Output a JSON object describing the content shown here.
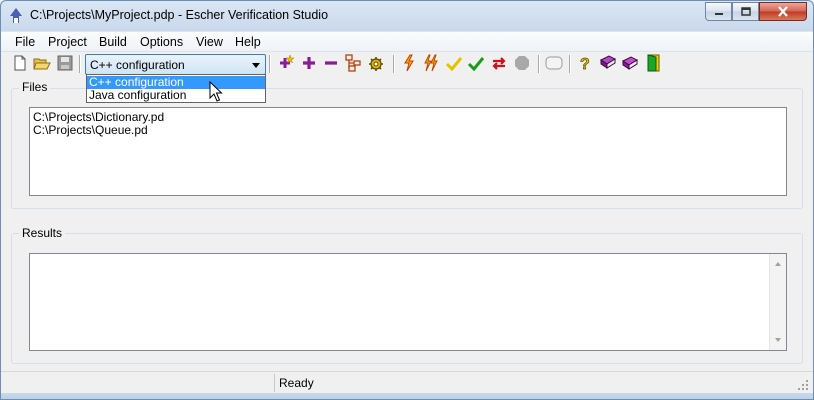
{
  "window": {
    "title": "C:\\Projects\\MyProject.pdp - Escher Verification Studio"
  },
  "menu": {
    "items": [
      "File",
      "Project",
      "Build",
      "Options",
      "View",
      "Help"
    ]
  },
  "toolbar": {
    "config_select": {
      "value": "C++ configuration",
      "options": [
        "C++ configuration",
        "Java configuration"
      ]
    },
    "icons": [
      "new-file-icon",
      "open-folder-icon",
      "save-icon",
      "add-star-icon",
      "add-plus-icon",
      "remove-minus-icon",
      "hierarchy-icon",
      "gear-icon",
      "build-icon",
      "build-all-icon",
      "check-icon",
      "verify-icon",
      "reverify-icon",
      "stop-icon",
      "blank-icon",
      "help-icon",
      "book-icon",
      "books-icon",
      "exit-icon"
    ]
  },
  "files_panel": {
    "label": "Files",
    "items": [
      "C:\\Projects\\Dictionary.pd",
      "C:\\Projects\\Queue.pd"
    ]
  },
  "results_panel": {
    "label": "Results"
  },
  "status": {
    "text": "Ready"
  },
  "colors": {
    "selection": "#3399ff",
    "frame": "#c9d9ec",
    "accent_red": "#c23a24"
  }
}
